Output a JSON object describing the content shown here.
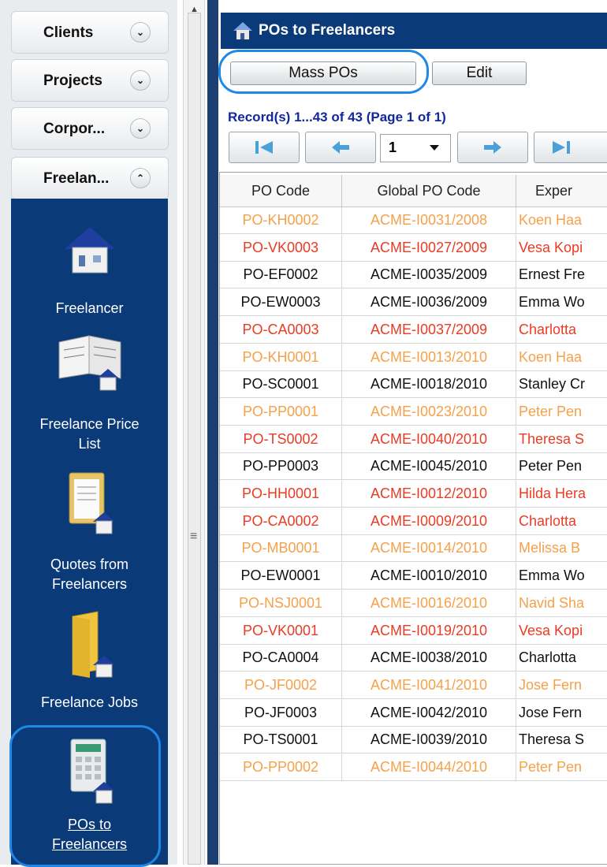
{
  "sidebar": {
    "sections": [
      {
        "label": "Clients",
        "toggle": "⌄"
      },
      {
        "label": "Projects",
        "toggle": "⌄"
      },
      {
        "label": "Corpor...",
        "toggle": "⌄"
      },
      {
        "label": "Freelan...",
        "toggle": "⌃"
      }
    ],
    "panel_items": [
      {
        "label_lines": [
          "Freelancer"
        ],
        "icon": "house-icon"
      },
      {
        "label_lines": [
          "Freelance Price",
          "List"
        ],
        "icon": "price-list-book-icon"
      },
      {
        "label_lines": [
          "Quotes from",
          "Freelancers"
        ],
        "icon": "quotes-clipboard-icon"
      },
      {
        "label_lines": [
          "Freelance Jobs"
        ],
        "icon": "jobs-folder-icon"
      },
      {
        "label_lines": [
          "POs to",
          "Freelancers"
        ],
        "icon": "po-calculator-icon"
      }
    ]
  },
  "main": {
    "title": "POs to Freelancers",
    "buttons": {
      "mass_pos": "Mass POs",
      "edit": "Edit"
    },
    "records_text": "Record(s) 1...43 of 43 (Page 1 of 1)",
    "page_select_value": "1",
    "columns": [
      "PO Code",
      "Global PO Code",
      "Exper"
    ],
    "row_colors": {
      "orange": "#f5a14a",
      "red": "#ea3b24",
      "black": "#111111"
    },
    "rows": [
      {
        "po": "PO-KH0002",
        "global": "ACME-I0031/2008",
        "name": "Koen Haa",
        "color": "orange"
      },
      {
        "po": "PO-VK0003",
        "global": "ACME-I0027/2009",
        "name": "Vesa Kopi",
        "color": "red"
      },
      {
        "po": "PO-EF0002",
        "global": "ACME-I0035/2009",
        "name": "Ernest Fre",
        "color": "black"
      },
      {
        "po": "PO-EW0003",
        "global": "ACME-I0036/2009",
        "name": "Emma Wo",
        "color": "black"
      },
      {
        "po": "PO-CA0003",
        "global": "ACME-I0037/2009",
        "name": "Charlotta ",
        "color": "red"
      },
      {
        "po": "PO-KH0001",
        "global": "ACME-I0013/2010",
        "name": "Koen Haa",
        "color": "orange"
      },
      {
        "po": "PO-SC0001",
        "global": "ACME-I0018/2010",
        "name": "Stanley Cr",
        "color": "black"
      },
      {
        "po": "PO-PP0001",
        "global": "ACME-I0023/2010",
        "name": "Peter Pen",
        "color": "orange"
      },
      {
        "po": "PO-TS0002",
        "global": "ACME-I0040/2010",
        "name": "Theresa S",
        "color": "red"
      },
      {
        "po": "PO-PP0003",
        "global": "ACME-I0045/2010",
        "name": "Peter Pen",
        "color": "black"
      },
      {
        "po": "PO-HH0001",
        "global": "ACME-I0012/2010",
        "name": "Hilda Hera",
        "color": "red"
      },
      {
        "po": "PO-CA0002",
        "global": "ACME-I0009/2010",
        "name": "Charlotta ",
        "color": "red"
      },
      {
        "po": "PO-MB0001",
        "global": "ACME-I0014/2010",
        "name": "Melissa B",
        "color": "orange"
      },
      {
        "po": "PO-EW0001",
        "global": "ACME-I0010/2010",
        "name": "Emma Wo",
        "color": "black"
      },
      {
        "po": "PO-NSJ0001",
        "global": "ACME-I0016/2010",
        "name": "Navid Sha",
        "color": "orange"
      },
      {
        "po": "PO-VK0001",
        "global": "ACME-I0019/2010",
        "name": "Vesa Kopi",
        "color": "red"
      },
      {
        "po": "PO-CA0004",
        "global": "ACME-I0038/2010",
        "name": "Charlotta ",
        "color": "black"
      },
      {
        "po": "PO-JF0002",
        "global": "ACME-I0041/2010",
        "name": "Jose Fern",
        "color": "orange"
      },
      {
        "po": "PO-JF0003",
        "global": "ACME-I0042/2010",
        "name": "Jose Fern",
        "color": "black"
      },
      {
        "po": "PO-TS0001",
        "global": "ACME-I0039/2010",
        "name": "Theresa S",
        "color": "black"
      },
      {
        "po": "PO-PP0002",
        "global": "ACME-I0044/2010",
        "name": "Peter Pen",
        "color": "orange"
      }
    ]
  }
}
